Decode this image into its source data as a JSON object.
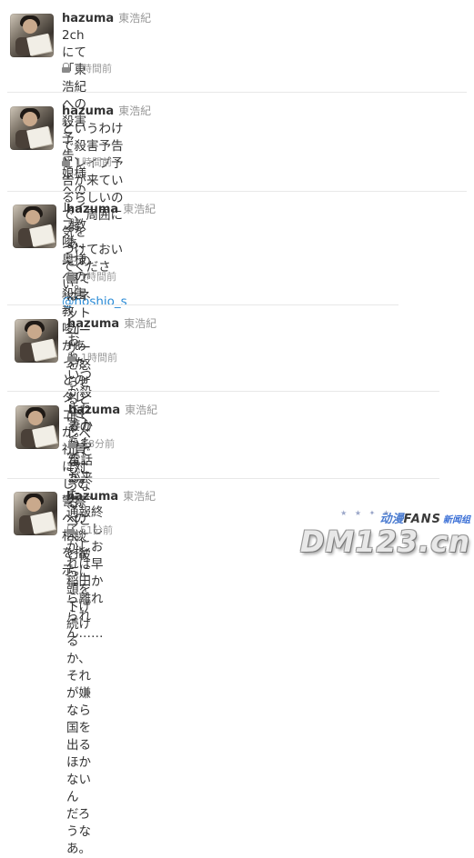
{
  "tweets": [
    {
      "screen_name": "hazuma",
      "real_name": "東浩紀",
      "lines": [
        "2chにて「東浩紀への殺害予告、娘様へのレイプ教唆、奥様への殺害",
        "教唆」があったとのタレコミが。社員に対して警察への相談を指示。"
      ],
      "time": "1時間前"
    },
    {
      "screen_name": "hazuma",
      "real_name": "東浩紀",
      "lines": [
        "というわけで殺害予告とレイプ予告が来ているらしいので、周囲に気を",
        "つけておいてください。"
      ],
      "mention": "@hoshio_s",
      "time": "1時間前"
    },
    {
      "screen_name": "hazuma",
      "real_name": "東浩紀",
      "lines": [
        "まあ、この国ではネットユーザーを怒らせるとぼくレベルでもこうなる。",
        "ぺこぺこと彼らに頭を下げ続けるか、それが嫌なら国を出るほかないん",
        "だろうなあ。"
      ],
      "time": "1時間前"
    },
    {
      "screen_name": "hazuma",
      "real_name": "東浩紀",
      "lines": [
        "おれ、いつか殺されるのかもなあ。"
      ],
      "time": "1時間前"
    },
    {
      "screen_name": "hazuma",
      "real_name": "東浩紀",
      "lines": [
        "妻からも電話が来た。。"
      ],
      "time": "58分前"
    },
    {
      "screen_name": "hazuma",
      "real_name": "東浩紀",
      "lines": [
        "通報終了。しかしおれは早稲田から離れられん……"
      ],
      "time": "51分前"
    }
  ],
  "watermark": {
    "top_a": "动漫",
    "top_b": "FANS",
    "top_c": "新闻组",
    "main": "DM123.cn"
  }
}
